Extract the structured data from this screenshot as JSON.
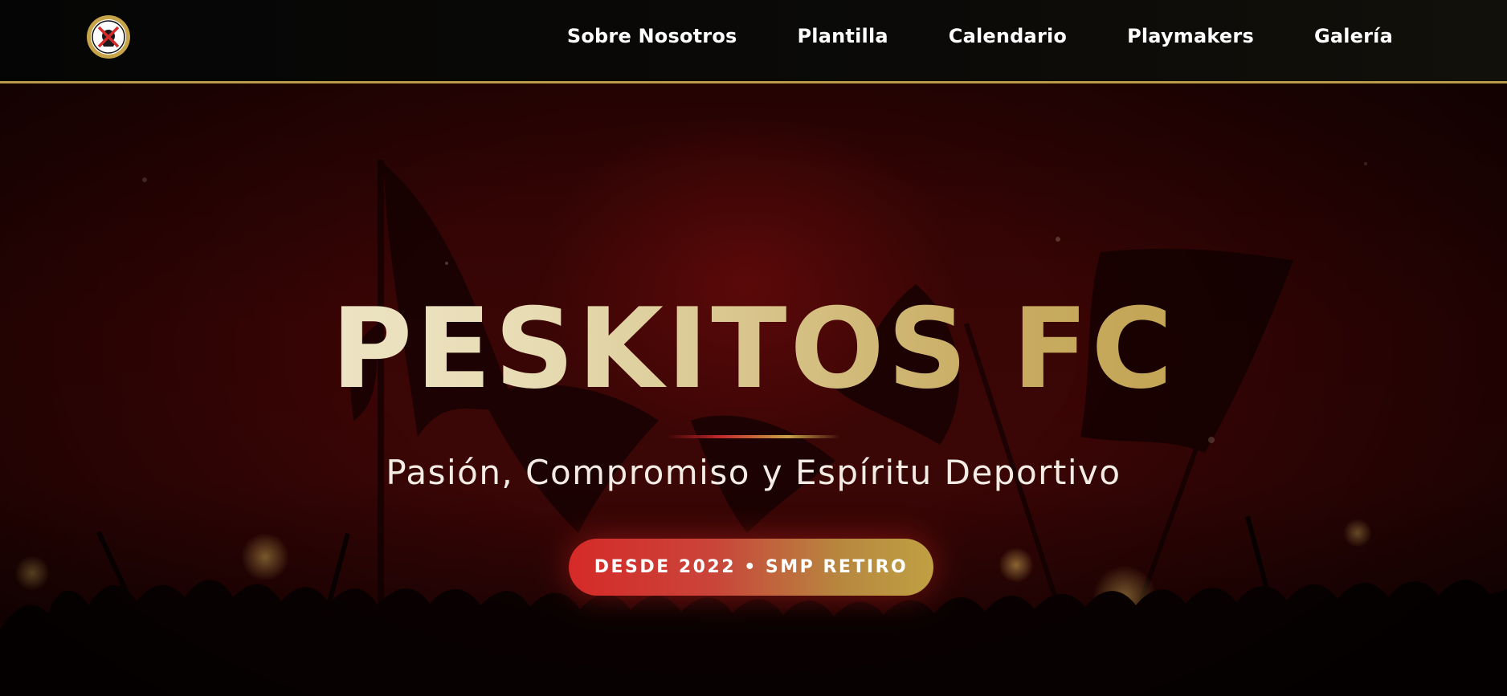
{
  "brand": {
    "logo_icon": "peskitos-crest-icon",
    "accent_gold": "#c7a449",
    "accent_red": "#d62a28"
  },
  "nav": {
    "items": [
      {
        "label": "Sobre Nosotros"
      },
      {
        "label": "Plantilla"
      },
      {
        "label": "Calendario"
      },
      {
        "label": "Playmakers"
      },
      {
        "label": "Galería"
      }
    ]
  },
  "hero": {
    "title": "PESKITOS FC",
    "subtitle": "Pasión, Compromiso y Espíritu Deportivo",
    "badge": "DESDE 2022 • SMP RETIRO",
    "background": "crowd-with-flags-silhouette"
  }
}
